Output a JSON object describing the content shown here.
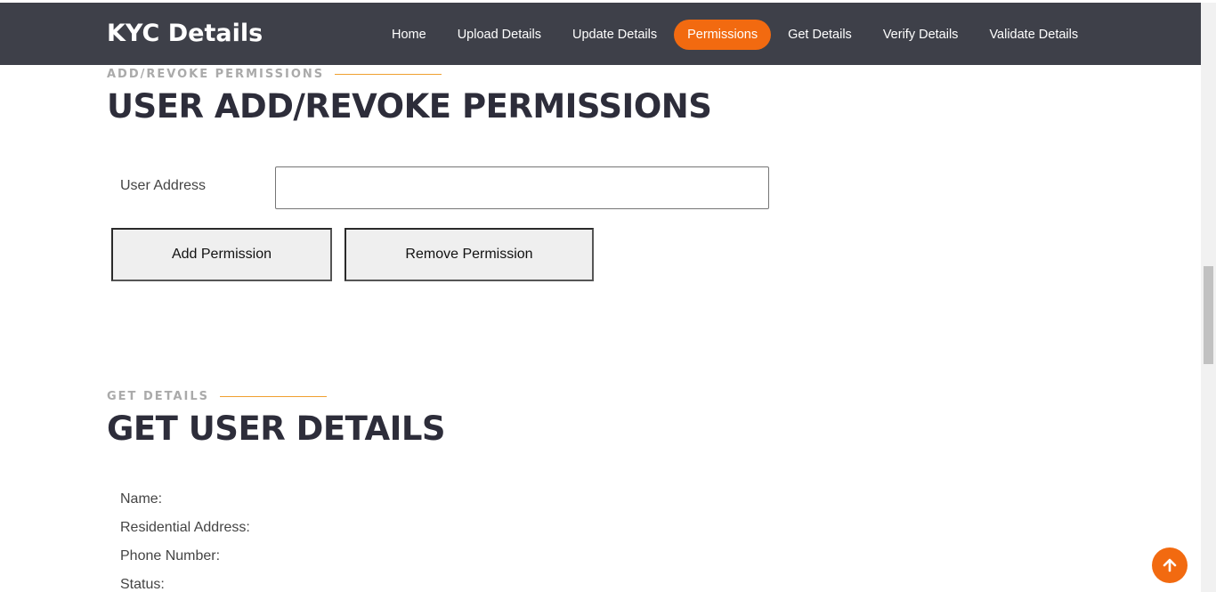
{
  "header": {
    "brand": "KYC Details",
    "nav": [
      {
        "label": "Home"
      },
      {
        "label": "Upload Details"
      },
      {
        "label": "Update Details"
      },
      {
        "label": "Permissions",
        "active": true
      },
      {
        "label": "Get Details"
      },
      {
        "label": "Verify Details"
      },
      {
        "label": "Validate Details"
      }
    ]
  },
  "permissions": {
    "tag": "ADD/REVOKE PERMISSIONS",
    "title": "USER ADD/REVOKE PERMISSIONS",
    "address_label": "User Address",
    "address_value": "",
    "add_button": "Add Permission",
    "remove_button": "Remove Permission"
  },
  "get_details": {
    "tag": "GET DETAILS",
    "title": "GET USER DETAILS",
    "fields": [
      {
        "label": "Name:"
      },
      {
        "label": "Residential Address:"
      },
      {
        "label": "Phone Number:"
      },
      {
        "label": "Status:"
      }
    ]
  },
  "colors": {
    "header_bg": "#3e4049",
    "accent": "#f26a10",
    "tag_line": "#f0a030",
    "title": "#2d2d3a"
  },
  "icons": {
    "back_to_top": "arrow-up-icon"
  }
}
